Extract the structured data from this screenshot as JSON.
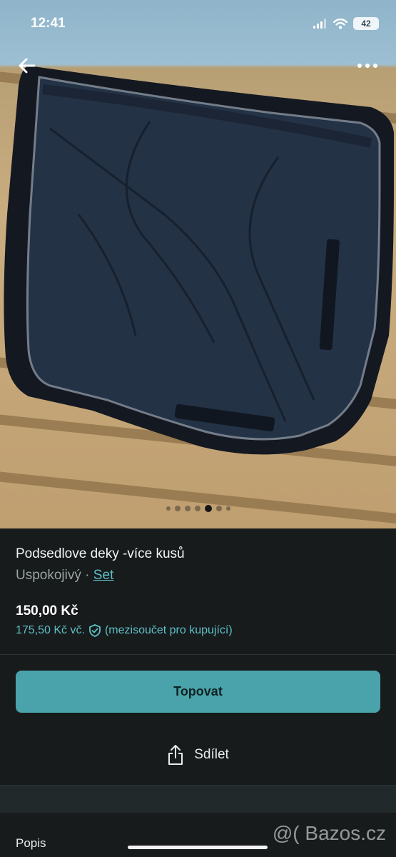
{
  "status_bar": {
    "time": "12:41",
    "battery": "42"
  },
  "gallery": {
    "image_count": 9,
    "active_index": 5
  },
  "listing": {
    "title": "Podsedlove deky -více kusů",
    "condition": "Uspokojivý",
    "separator": "·",
    "category_link": "Set",
    "price": "150,00 Kč",
    "buyer_price": "175,50 Kč vč.",
    "buyer_note": "(mezisoučet pro kupující)"
  },
  "actions": {
    "primary_label": "Topovat",
    "share_label": "Sdílet"
  },
  "section": {
    "description_label": "Popis"
  },
  "watermark": "@( Bazos.cz",
  "colors": {
    "accent": "#4aa3aa",
    "link": "#5fbfc6",
    "background": "#171b1c"
  },
  "icons": [
    "back-arrow-icon",
    "more-dots-icon",
    "signal-icon",
    "wifi-icon",
    "battery-icon",
    "shield-check-icon",
    "share-icon"
  ]
}
